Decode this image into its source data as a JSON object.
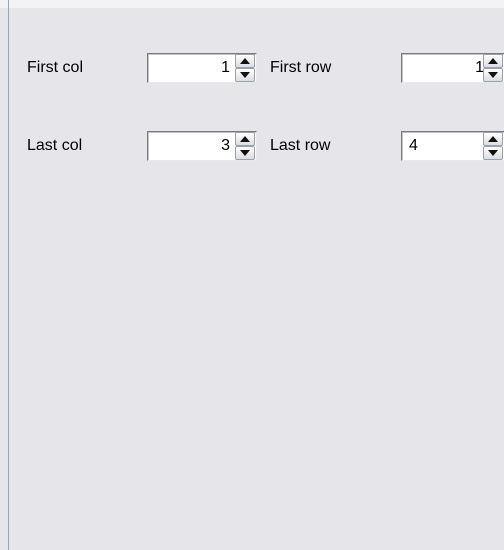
{
  "form": {
    "first_col": {
      "label": "First col",
      "value": "1"
    },
    "first_row": {
      "label": "First row",
      "value": "1"
    },
    "last_col": {
      "label": "Last col",
      "value": "3"
    },
    "last_row": {
      "label": "Last row",
      "value": "4"
    }
  },
  "icons": {
    "spin_up": "spin-up-arrow-icon",
    "spin_down": "spin-down-arrow-icon"
  },
  "colors": {
    "panel_background": "#e6e5ea",
    "field_background": "#ffffff"
  }
}
